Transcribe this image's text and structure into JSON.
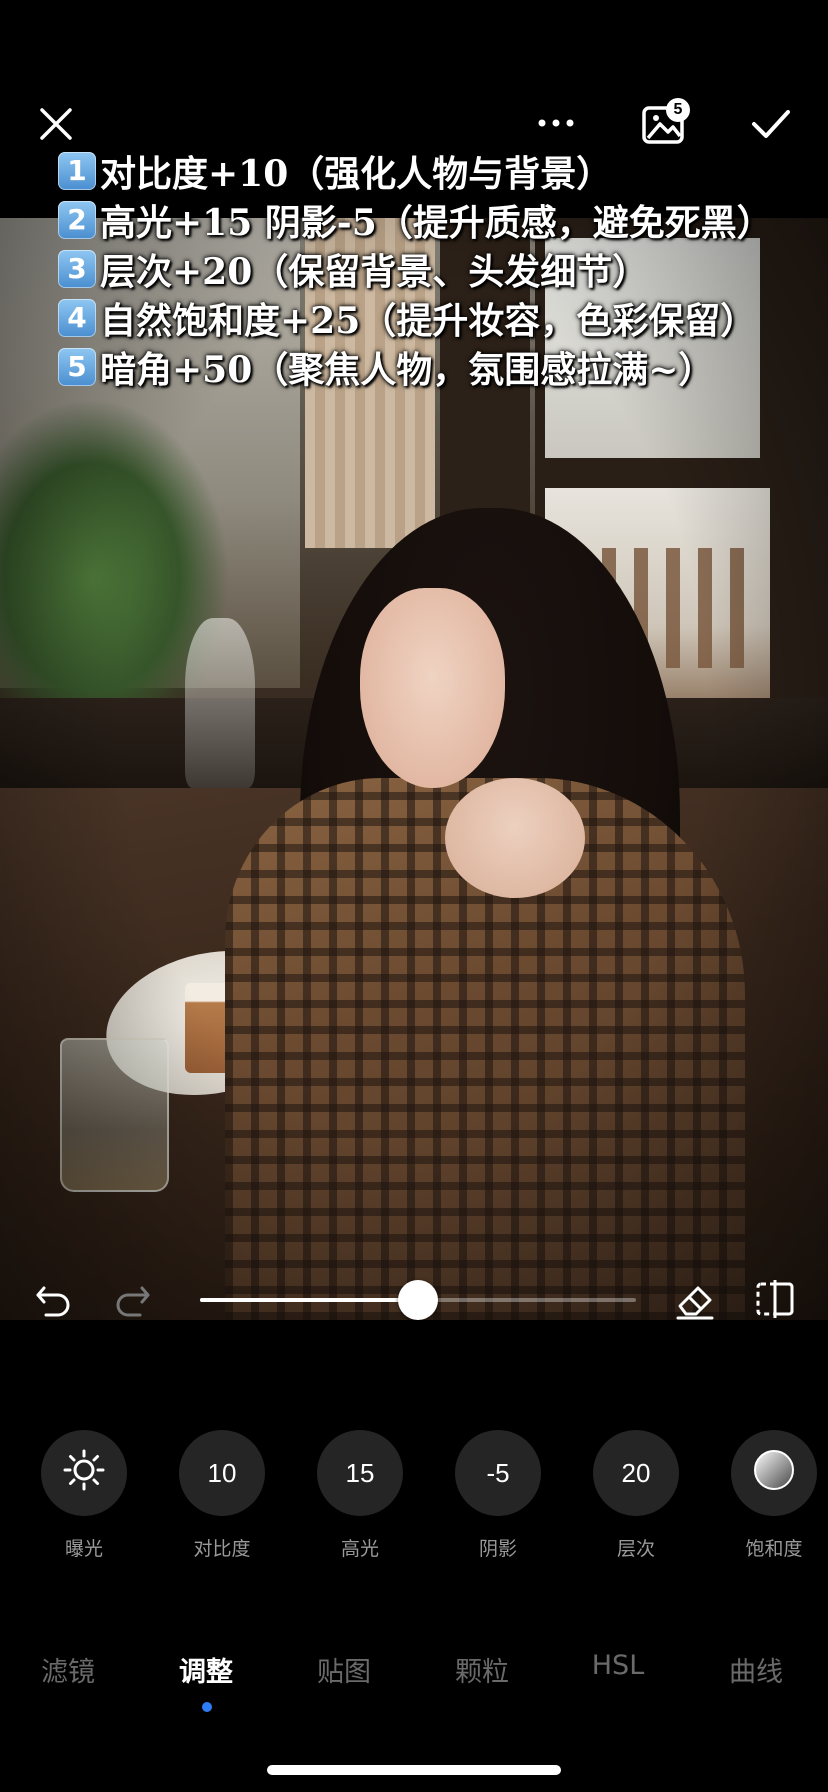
{
  "header": {
    "close": "close-icon",
    "more": "more-icon",
    "gallery_badge": "5",
    "confirm": "check-icon"
  },
  "notes": [
    {
      "num": "1",
      "text": "对比度+10（强化人物与背景）"
    },
    {
      "num": "2",
      "text": "高光+15 阴影-5（提升质感，避免死黑）"
    },
    {
      "num": "3",
      "text": "层次+20（保留背景、头发细节）"
    },
    {
      "num": "4",
      "text": "自然饱和度+25（提升妆容，色彩保留）"
    },
    {
      "num": "5",
      "text": "暗角+50（聚焦人物，氛围感拉满~）"
    }
  ],
  "slider": {
    "value_fraction": 0.5
  },
  "tools": [
    {
      "label": "曝光",
      "value": "",
      "icon": "sun-icon"
    },
    {
      "label": "对比度",
      "value": "10"
    },
    {
      "label": "高光",
      "value": "15"
    },
    {
      "label": "阴影",
      "value": "-5"
    },
    {
      "label": "层次",
      "value": "20"
    },
    {
      "label": "饱和度",
      "value": "",
      "icon": "saturation-icon"
    }
  ],
  "tabs": [
    {
      "label": "滤镜"
    },
    {
      "label": "调整",
      "active": true
    },
    {
      "label": "贴图"
    },
    {
      "label": "颗粒"
    },
    {
      "label": "HSL"
    },
    {
      "label": "曲线"
    }
  ],
  "colors": {
    "accent_dot": "#2f7df6",
    "tool_bg": "#252525",
    "inactive_text": "#6a6a6a"
  }
}
